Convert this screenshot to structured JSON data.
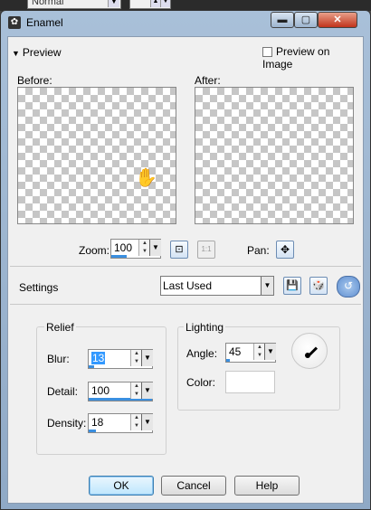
{
  "host": {
    "mode_value": "Normal"
  },
  "window": {
    "title": "Enamel",
    "min_glyph": "▬",
    "max_glyph": "▢",
    "close_glyph": "✕"
  },
  "preview": {
    "section_label": "Preview",
    "preview_on_image_label": "Preview on Image",
    "preview_on_image_checked": false,
    "before_label": "Before:",
    "after_label": "After:"
  },
  "zoom": {
    "label": "Zoom:",
    "value": "100",
    "fill_fraction": 0.55
  },
  "pan": {
    "label": "Pan:"
  },
  "settings": {
    "label": "Settings",
    "preset_value": "Last Used"
  },
  "relief": {
    "title": "Relief",
    "blur": {
      "label": "Blur:",
      "value": "13",
      "fill_fraction": 0.13
    },
    "detail": {
      "label": "Detail:",
      "value": "100",
      "fill_fraction": 1.0
    },
    "density": {
      "label": "Density:",
      "value": "18",
      "fill_fraction": 0.18
    }
  },
  "lighting": {
    "title": "Lighting",
    "angle": {
      "label": "Angle:",
      "value": "45",
      "fill_fraction": 0.125
    },
    "color_label": "Color:",
    "color_value": "#ffffff"
  },
  "buttons": {
    "ok": "OK",
    "cancel": "Cancel",
    "help": "Help"
  }
}
